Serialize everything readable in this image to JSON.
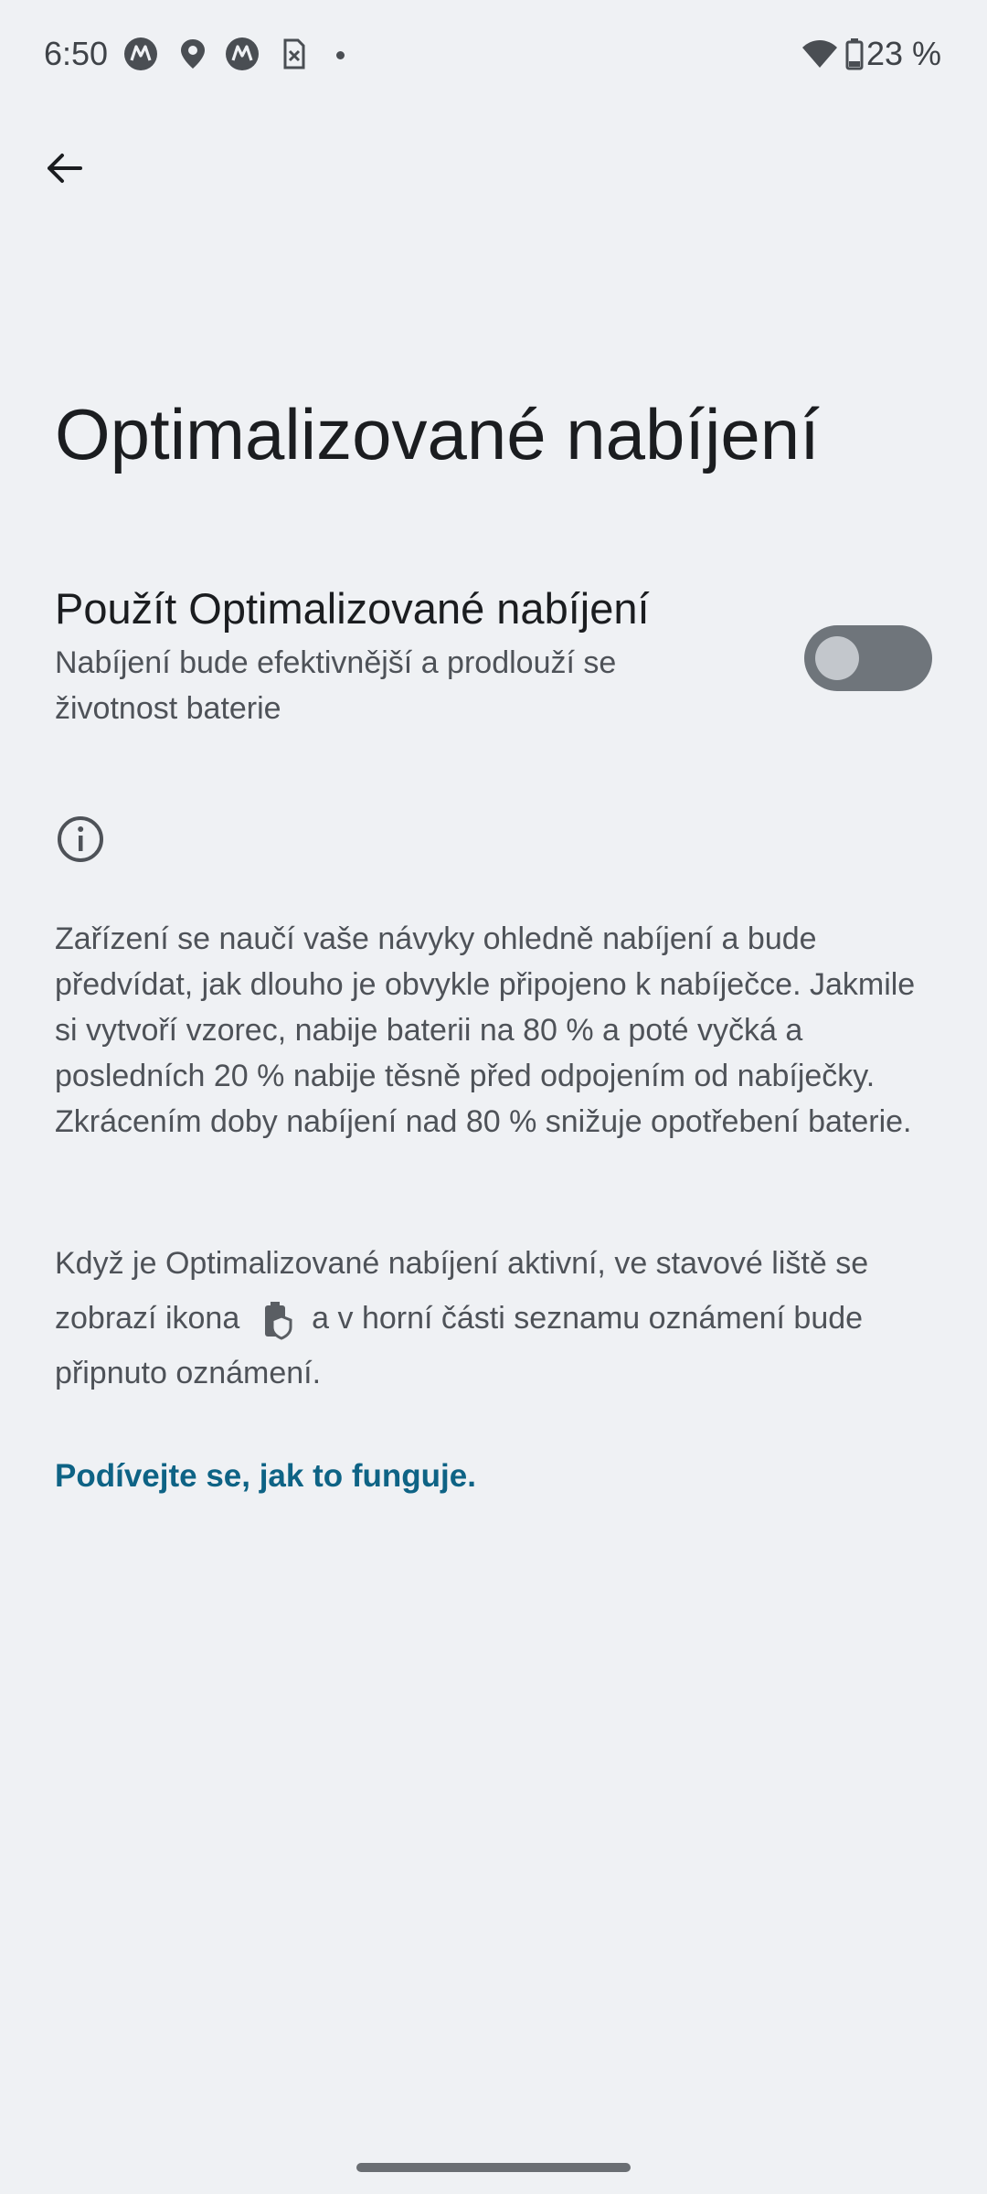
{
  "status_bar": {
    "time": "6:50",
    "battery_percent": "23 %",
    "icons": [
      "moto-icon",
      "location-icon",
      "moto-icon",
      "sim-off-icon",
      "dot-icon",
      "wifi-icon",
      "battery-icon"
    ]
  },
  "page": {
    "title": "Optimalizované nabíjení"
  },
  "setting": {
    "title": "Použít Optimalizované nabíjení",
    "summary": "Nabíjení bude efektivnější a prodlouží se životnost baterie",
    "toggle_on": false
  },
  "info": {
    "paragraph1": "Zařízení se naučí vaše návyky ohledně nabíjení a bude předvídat, jak dlouho je obvykle připojeno k nabíječce. Jakmile si vytvoří vzorec, nabije baterii na 80 % a poté vyčká a posledních 20 % nabije těsně před odpojením od nabíječky. Zkrácením doby nabíjení nad 80 % snižuje opotřebení baterie.",
    "paragraph2_before": "Když je Optimalizované nabíjení aktivní, ve stavové liště se zobrazí ikona",
    "paragraph2_after": "a v horní části seznamu oznámení bude připnuto oznámení.",
    "link": "Podívejte se, jak to funguje."
  },
  "colors": {
    "background": "#eff1f4",
    "link": "#0e6385",
    "toggle_track": "#6f757b"
  }
}
